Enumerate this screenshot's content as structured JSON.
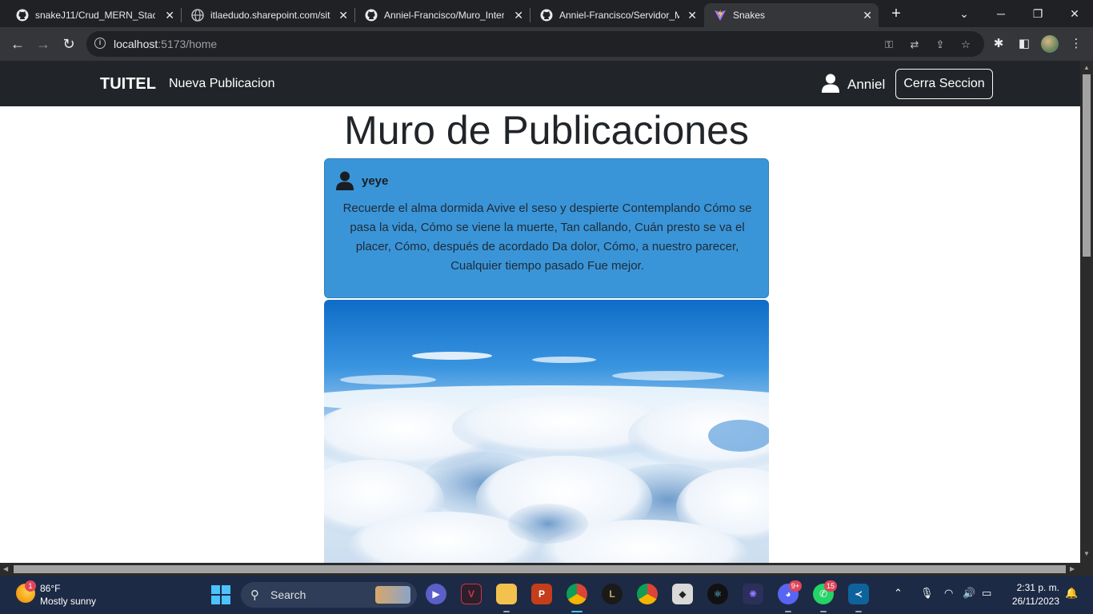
{
  "browser": {
    "tabs": [
      {
        "title": "snakeJ11/Crud_MERN_Stack",
        "icon": "github-icon",
        "active": false
      },
      {
        "title": "itlaedudo.sharepoint.com/sit",
        "icon": "globe-icon",
        "active": false
      },
      {
        "title": "Anniel-Francisco/Muro_Inter",
        "icon": "github-icon",
        "active": false
      },
      {
        "title": "Anniel-Francisco/Servidor_M",
        "icon": "github-icon",
        "active": false
      },
      {
        "title": "Snakes",
        "icon": "vite-icon",
        "active": true
      }
    ],
    "url_host": "localhost",
    "url_path": ":5173/home"
  },
  "app": {
    "brand": "TUITEL",
    "nav_link": "Nueva Publicacion",
    "user_name": "Anniel",
    "logout_label": "Cerra Seccion",
    "page_title": "Muro de Publicaciones",
    "posts": [
      {
        "author": "yeye",
        "body": "Recuerde el alma dormida Avive el seso y despierte Contemplando Cómo se pasa la vida, Cómo se viene la muerte, Tan callando, Cuán presto se va el placer, Cómo, después de acordado Da dolor, Cómo, a nuestro parecer, Cualquier tiempo pasado Fue mejor.",
        "card_color": "#3a95d8",
        "image": "sky-clouds-photo"
      }
    ]
  },
  "taskbar": {
    "weather_badge": "1",
    "weather_temp": "86°F",
    "weather_desc": "Mostly sunny",
    "search_label": "Search",
    "discord_badge": "9+",
    "whatsapp_badge": "15",
    "time": "2:31 p. m.",
    "date": "26/11/2023"
  }
}
